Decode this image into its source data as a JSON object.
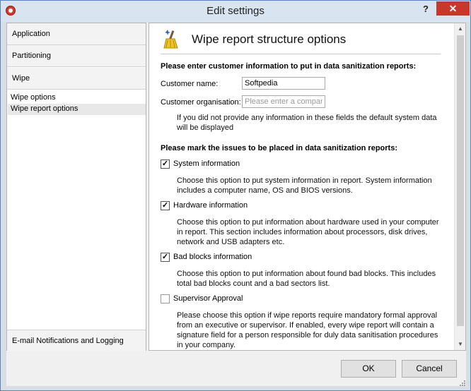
{
  "window": {
    "title": "Edit settings",
    "help": "?",
    "close": "✕",
    "icon": "app-logo-icon"
  },
  "sidebar": {
    "sections": [
      {
        "label": "Application"
      },
      {
        "label": "Partitioning"
      },
      {
        "label": "Wipe"
      }
    ],
    "subitems": [
      {
        "label": "Wipe options",
        "selected": false
      },
      {
        "label": "Wipe report options",
        "selected": true
      }
    ],
    "bottom_section": {
      "label": "E-mail Notifications and Logging"
    }
  },
  "panel": {
    "icon": "wipe-report-broom-icon",
    "title": "Wipe report structure options",
    "customer_section": "Please enter customer information to put in data sanitization reports:",
    "customer_name": {
      "label": "Customer name:",
      "value": "Softpedia"
    },
    "customer_org": {
      "label": "Customer organisation:",
      "placeholder": "Please enter a company",
      "value": ""
    },
    "default_note": "If you did not provide any information in these fields the default system data will be displayed",
    "issues_section": "Please mark the issues to be placed in data sanitization reports:",
    "options": [
      {
        "label": "System information",
        "checked": true,
        "desc": "Choose this option to put system information in report. System information includes a computer name, OS and BIOS versions."
      },
      {
        "label": "Hardware information",
        "checked": true,
        "desc": "Choose this option to put information about hardware used in your computer in report. This section includes information about processors, disk drives, network and USB adapters etc."
      },
      {
        "label": "Bad blocks information",
        "checked": true,
        "desc": "Choose this option to put information about found bad blocks. This includes total bad blocks count and a bad sectors list."
      },
      {
        "label": "Supervisor Approval",
        "checked": false,
        "desc": "Please choose this option if wipe reports require mandatory formal approval from an executive or supervisor. If enabled, every wipe report will contain a signature field for a person responsible for duly data sanitisation procedures in your company."
      }
    ],
    "checkmark": "✓"
  },
  "buttons": {
    "ok": "OK",
    "cancel": "Cancel"
  },
  "colors": {
    "titlebar": "#d9e4f1",
    "close": "#c7372b",
    "window_border": "#5a86bd"
  }
}
